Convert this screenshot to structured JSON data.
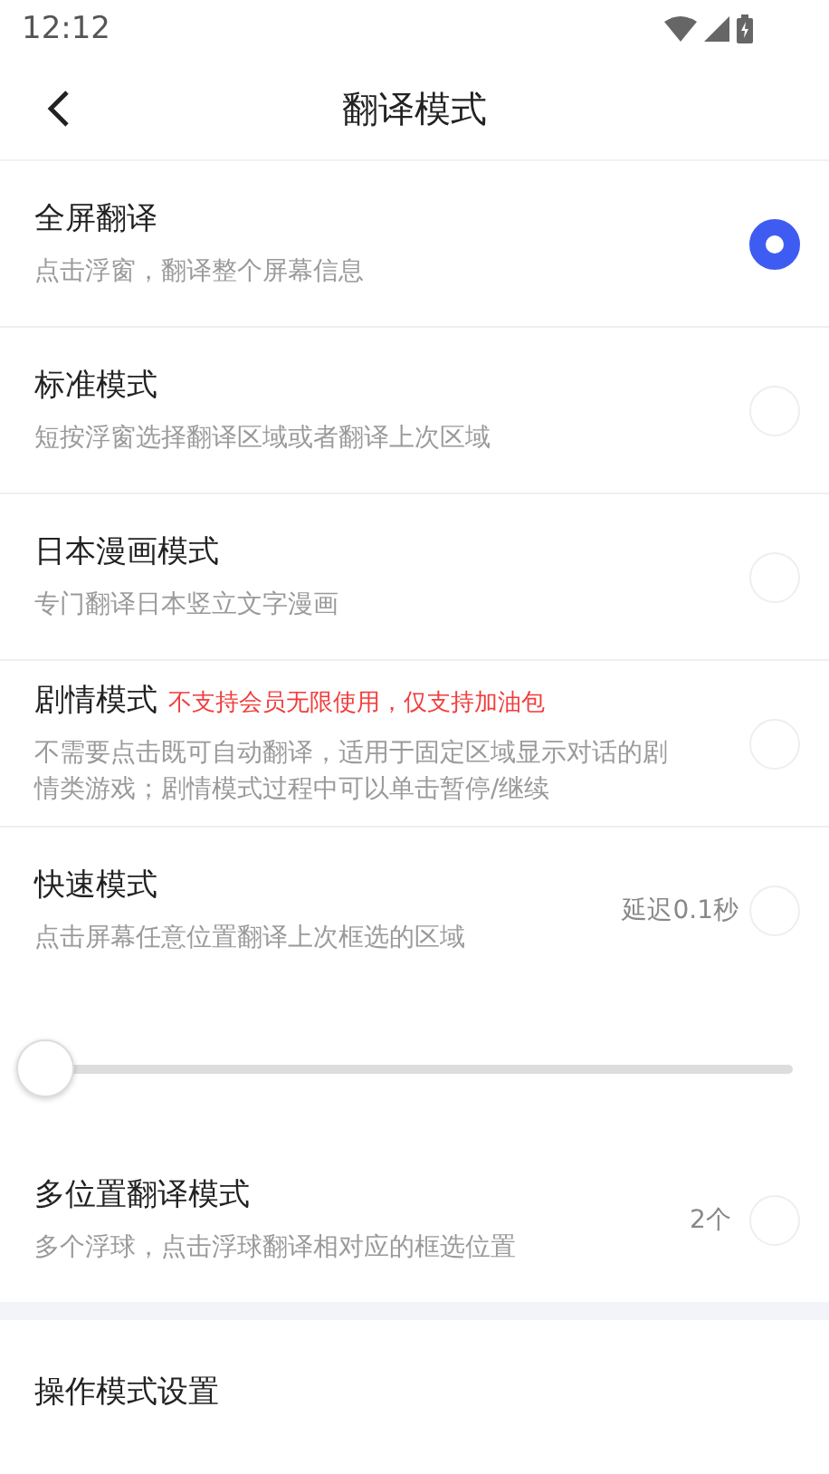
{
  "status_bar": {
    "time": "12:12"
  },
  "header": {
    "title": "翻译模式"
  },
  "modes": [
    {
      "title": "全屏翻译",
      "description": "点击浮窗，翻译整个屏幕信息",
      "selected": true
    },
    {
      "title": "标准模式",
      "description": "短按浮窗选择翻译区域或者翻译上次区域",
      "selected": false
    },
    {
      "title": "日本漫画模式",
      "description": "专门翻译日本竖立文字漫画",
      "selected": false
    },
    {
      "title": "剧情模式",
      "note": "不支持会员无限使用，仅支持加油包",
      "description": "不需要点击既可自动翻译，适用于固定区域显示对话的剧情类游戏；剧情模式过程中可以单击暂停/继续",
      "selected": false
    },
    {
      "title": "快速模式",
      "description": "点击屏幕任意位置翻译上次框选的区域",
      "value": "延迟0.1秒",
      "selected": false,
      "slider": {
        "level": 0
      }
    },
    {
      "title": "多位置翻译模式",
      "description": "多个浮球，点击浮球翻译相对应的框选位置",
      "value": "2个",
      "selected": false
    }
  ],
  "settings": {
    "label": "操作模式设置"
  }
}
